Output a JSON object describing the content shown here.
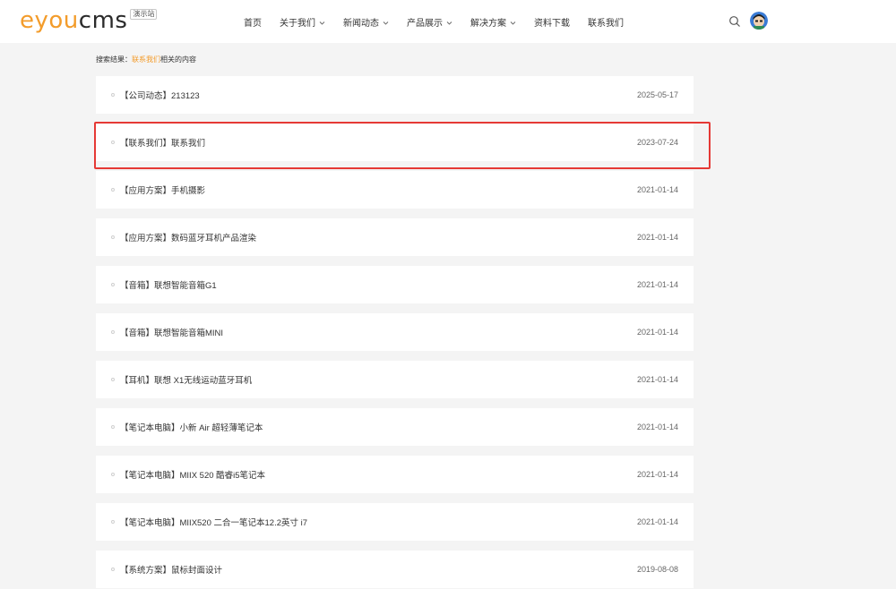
{
  "brand": {
    "logo_main": "eyou",
    "logo_suffix": "cms",
    "logo_badge": "演示站"
  },
  "nav": {
    "items": [
      {
        "label": "首页",
        "has_dropdown": false
      },
      {
        "label": "关于我们",
        "has_dropdown": true
      },
      {
        "label": "新闻动态",
        "has_dropdown": true
      },
      {
        "label": "产品展示",
        "has_dropdown": true
      },
      {
        "label": "解决方案",
        "has_dropdown": true
      },
      {
        "label": "资料下载",
        "has_dropdown": false
      },
      {
        "label": "联系我们",
        "has_dropdown": false
      }
    ]
  },
  "header_icons": {
    "search": "search-icon",
    "avatar": "user-avatar"
  },
  "breadcrumb": {
    "prefix": "搜索结果：",
    "keyword": "联系我们",
    "suffix": "相关的内容"
  },
  "results": [
    {
      "title": "【公司动态】213123",
      "date": "2025-05-17"
    },
    {
      "title": "【联系我们】联系我们",
      "date": "2023-07-24"
    },
    {
      "title": "【应用方案】手机摄影",
      "date": "2021-01-14"
    },
    {
      "title": "【应用方案】数码蓝牙耳机产品渲染",
      "date": "2021-01-14"
    },
    {
      "title": "【音箱】联想智能音箱G1",
      "date": "2021-01-14"
    },
    {
      "title": "【音箱】联想智能音箱MINI",
      "date": "2021-01-14"
    },
    {
      "title": "【耳机】联想 X1无线运动蓝牙耳机",
      "date": "2021-01-14"
    },
    {
      "title": "【笔记本电脑】小新 Air 超轻薄笔记本",
      "date": "2021-01-14"
    },
    {
      "title": "【笔记本电脑】MIIX 520 酷睿i5笔记本",
      "date": "2021-01-14"
    },
    {
      "title": "【笔记本电脑】MIIX520 二合一笔记本12.2英寸 i7",
      "date": "2021-01-14"
    },
    {
      "title": "【系统方案】鼠标封面设计",
      "date": "2019-08-08"
    }
  ],
  "colors": {
    "accent": "#f39c2b",
    "highlight_box": "#e53935",
    "page_bg": "#f4f4f4"
  }
}
